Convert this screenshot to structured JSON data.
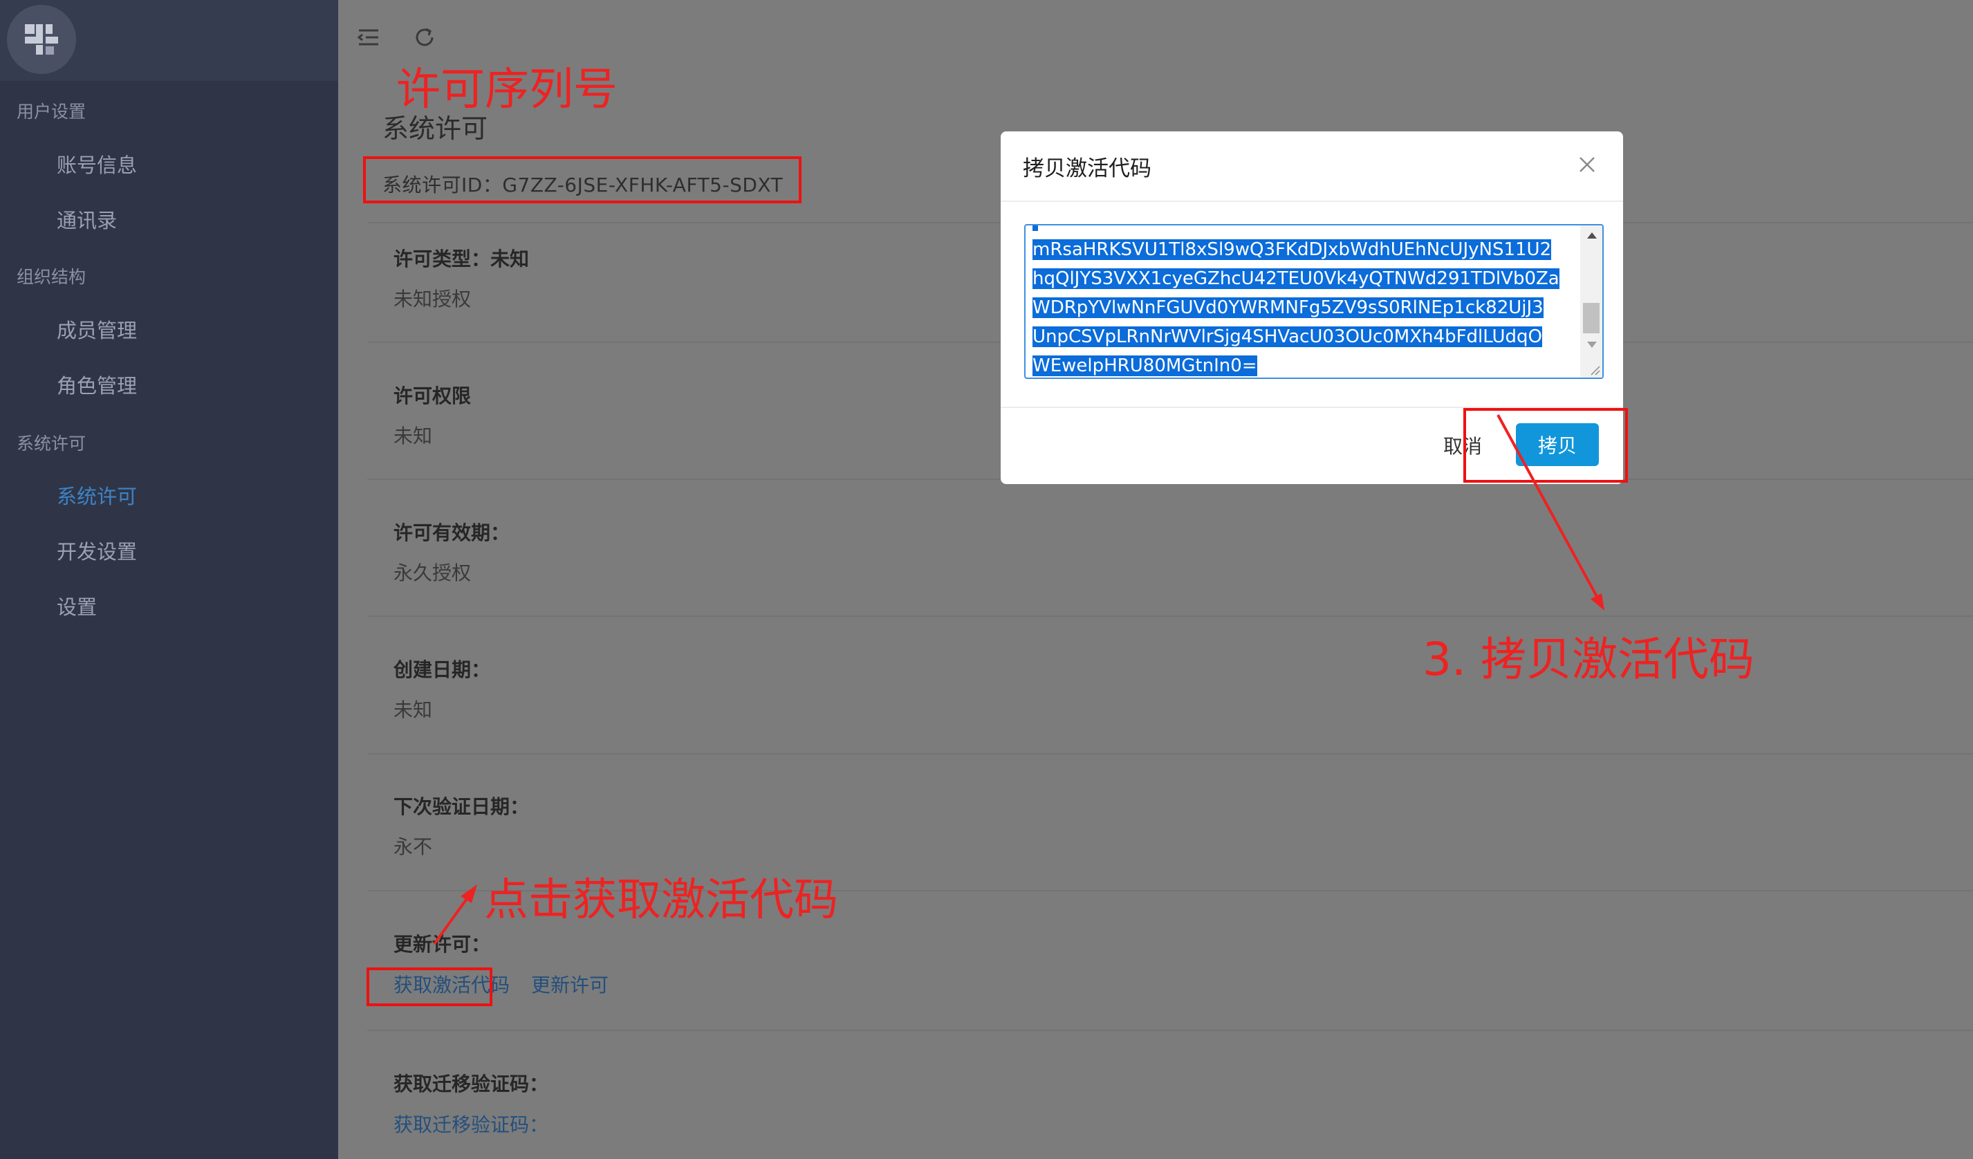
{
  "sidebar": {
    "groups": [
      {
        "title": "用户设置",
        "items": [
          "账号信息",
          "通讯录"
        ]
      },
      {
        "title": "组织结构",
        "items": [
          "成员管理",
          "角色管理"
        ]
      },
      {
        "title": "系统许可",
        "items": [
          "系统许可",
          "开发设置",
          "设置"
        ]
      }
    ],
    "active_item": "系统许可"
  },
  "toolbar": {
    "icons": [
      "menu-fold-icon",
      "refresh-icon"
    ]
  },
  "page": {
    "title": "系统许可",
    "license_id": "系统许可ID：G7ZZ-6JSE-XFHK-AFT5-SDXT",
    "fields": [
      {
        "label": "许可类型：未知",
        "value": "未知授权"
      },
      {
        "label": "许可权限",
        "value": "未知"
      },
      {
        "label": "许可有效期：",
        "value": "永久授权"
      },
      {
        "label": "创建日期：",
        "value": "未知"
      },
      {
        "label": "下次验证日期：",
        "value": "永不"
      },
      {
        "label": "更新许可："
      },
      {
        "label": "获取迁移验证码："
      }
    ],
    "update_links": {
      "get_activation": "获取激活代码",
      "update_license": "更新许可"
    },
    "migration_link": "获取迁移验证码："
  },
  "dialog": {
    "title": "拷贝激活代码",
    "code_lines": [
      "mRsaHRKSVU1Tl8xSl9wQ3FKdDJxbWdhUEhNcUJyNS11U2",
      "hqQlJYS3VXX1cyeGZhcU42TEU0Vk4yQTNWd291TDlVb0Za",
      "WDRpYVlwNnFGUVd0YWRMNFg5ZV9sS0RlNEp1ck82UjJ3",
      "UnpCSVpLRnNrWVlrSjg4SHVacU03OUc0MXh4bFdlLUdqO",
      "WEwelpHRU80MGtnIn0="
    ],
    "cancel_label": "取消",
    "copy_label": "拷贝"
  },
  "annotations": {
    "license_serial": "许可序列号",
    "click_get_code": "点击获取激活代码",
    "copy_code": "3. 拷贝激活代码",
    "color": "#ee2222"
  },
  "colors": {
    "sidebar_bg": "#2f3547",
    "active_nav": "#3d83c8",
    "primary_button": "#1296db",
    "selection": "#0b6cda"
  }
}
